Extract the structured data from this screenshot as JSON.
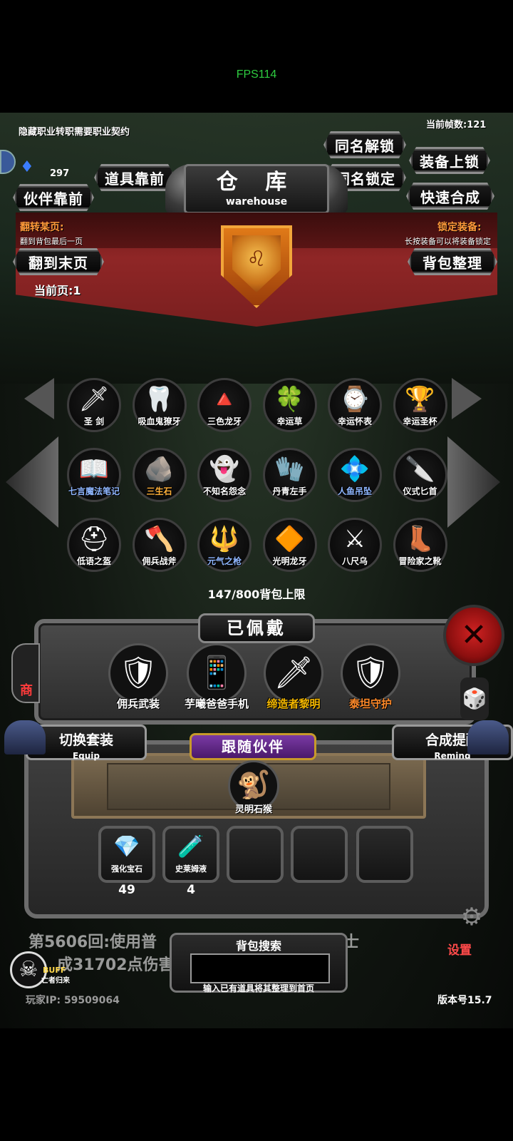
{
  "fps": "FPS114",
  "top": {
    "hidden_job_notice": "隐藏职业转职需要职业契约",
    "frame_count": "当前帧数:121",
    "gem_count": "297"
  },
  "buttons": {
    "same_name_unlock": "同名解锁",
    "same_name_lock": "同名锁定",
    "equip_lock": "装备上锁",
    "quick_merge": "快速合成",
    "items_front": "道具靠前",
    "companion_front": "伙伴靠前",
    "goto_last": "翻到末页",
    "bag_sort": "背包整理"
  },
  "warehouse": {
    "title_cn": "仓 库",
    "title_en": "warehouse"
  },
  "banner": {
    "flip_label": "翻转某页:",
    "flip_sub": "翻到背包最后一页",
    "lock_label": "锁定装备:",
    "lock_sub": "长按装备可以将装备锁定",
    "current_page": "当前页:1"
  },
  "items": [
    {
      "label": "圣 剑",
      "icon": "sword-icon",
      "glyph": "🗡",
      "color": "#ffffff"
    },
    {
      "label": "吸血鬼獠牙",
      "icon": "fang-icon",
      "glyph": "🦷",
      "color": "#ffffff"
    },
    {
      "label": "三色龙牙",
      "icon": "tricolor-fang-icon",
      "glyph": "🔺",
      "color": "#ffffff"
    },
    {
      "label": "幸运草",
      "icon": "clover-icon",
      "glyph": "🍀",
      "color": "#ffffff"
    },
    {
      "label": "幸运怀表",
      "icon": "pocket-watch-icon",
      "glyph": "⌚",
      "color": "#ffffff"
    },
    {
      "label": "幸运圣杯",
      "icon": "grail-icon",
      "glyph": "🏆",
      "color": "#ffffff"
    },
    {
      "label": "七言魔法笔记",
      "icon": "magic-book-icon",
      "glyph": "📖",
      "color": "#8fb6ff"
    },
    {
      "label": "三生石",
      "icon": "stone-icon",
      "glyph": "🪨",
      "color": "#ffb13b"
    },
    {
      "label": "不知名怨念",
      "icon": "ghost-icon",
      "glyph": "👻",
      "color": "#ffffff"
    },
    {
      "label": "丹青左手",
      "icon": "glove-icon",
      "glyph": "🧤",
      "color": "#ffffff"
    },
    {
      "label": "人鱼吊坠",
      "icon": "pendant-icon",
      "glyph": "💠",
      "color": "#8fb6ff"
    },
    {
      "label": "仪式匕首",
      "icon": "dagger-icon",
      "glyph": "🔪",
      "color": "#ffffff"
    },
    {
      "label": "低语之盔",
      "icon": "helmet-icon",
      "glyph": "⛑",
      "color": "#ffffff"
    },
    {
      "label": "佣兵战斧",
      "icon": "axe-icon",
      "glyph": "🪓",
      "color": "#ffffff"
    },
    {
      "label": "元气之枪",
      "icon": "spear-icon",
      "glyph": "🔱",
      "color": "#8fb6ff"
    },
    {
      "label": "光明龙牙",
      "icon": "light-fang-icon",
      "glyph": "🔶",
      "color": "#ffffff"
    },
    {
      "label": "八尺乌",
      "icon": "crossed-weapons-icon",
      "glyph": "⚔",
      "color": "#ffffff"
    },
    {
      "label": "冒险家之靴",
      "icon": "boots-icon",
      "glyph": "👢",
      "color": "#ffffff"
    }
  ],
  "capacity": "147/800背包上限",
  "equipped": {
    "title": "已佩戴",
    "items": [
      {
        "label": "佣兵武装",
        "icon": "armor-icon",
        "glyph": "🛡",
        "color": "#ffffff"
      },
      {
        "label": "芋曦爸爸手机",
        "icon": "phone-icon",
        "glyph": "📱",
        "color": "#ffffff"
      },
      {
        "label": "缔造者黎明",
        "icon": "greatsword-icon",
        "glyph": "🗡",
        "color": "#f5b800"
      },
      {
        "label": "泰坦守护",
        "icon": "titan-armor-icon",
        "glyph": "🛡",
        "color": "#ff8a2a"
      }
    ]
  },
  "switch_set": {
    "cn": "切换套装",
    "en": "Equip"
  },
  "merge_remind": {
    "cn": "合成提醒",
    "en": "Remind"
  },
  "companion": {
    "title": "跟随伙伴",
    "name": "灵明石猴",
    "glyph": "🐒"
  },
  "materials": [
    {
      "label": "强化宝石",
      "count": "49",
      "icon": "upgrade-gem-icon",
      "glyph": "💎"
    },
    {
      "label": "史莱姆液",
      "count": "4",
      "icon": "slime-potion-icon",
      "glyph": "🧪"
    }
  ],
  "battle_log": {
    "line1": "第5606回:使用普",
    "line1_end": "头人战士",
    "line2": "成31702点伤害"
  },
  "search": {
    "title": "背包搜索",
    "value": "",
    "hint": "输入已有道具将其整理到首页"
  },
  "bottom": {
    "player_ip": "玩家IP:  59509064",
    "version": "版本号15.7",
    "buff": "BUFF",
    "buff_sub": "亡者归来",
    "settings": "设置",
    "shop_partial": "商"
  }
}
